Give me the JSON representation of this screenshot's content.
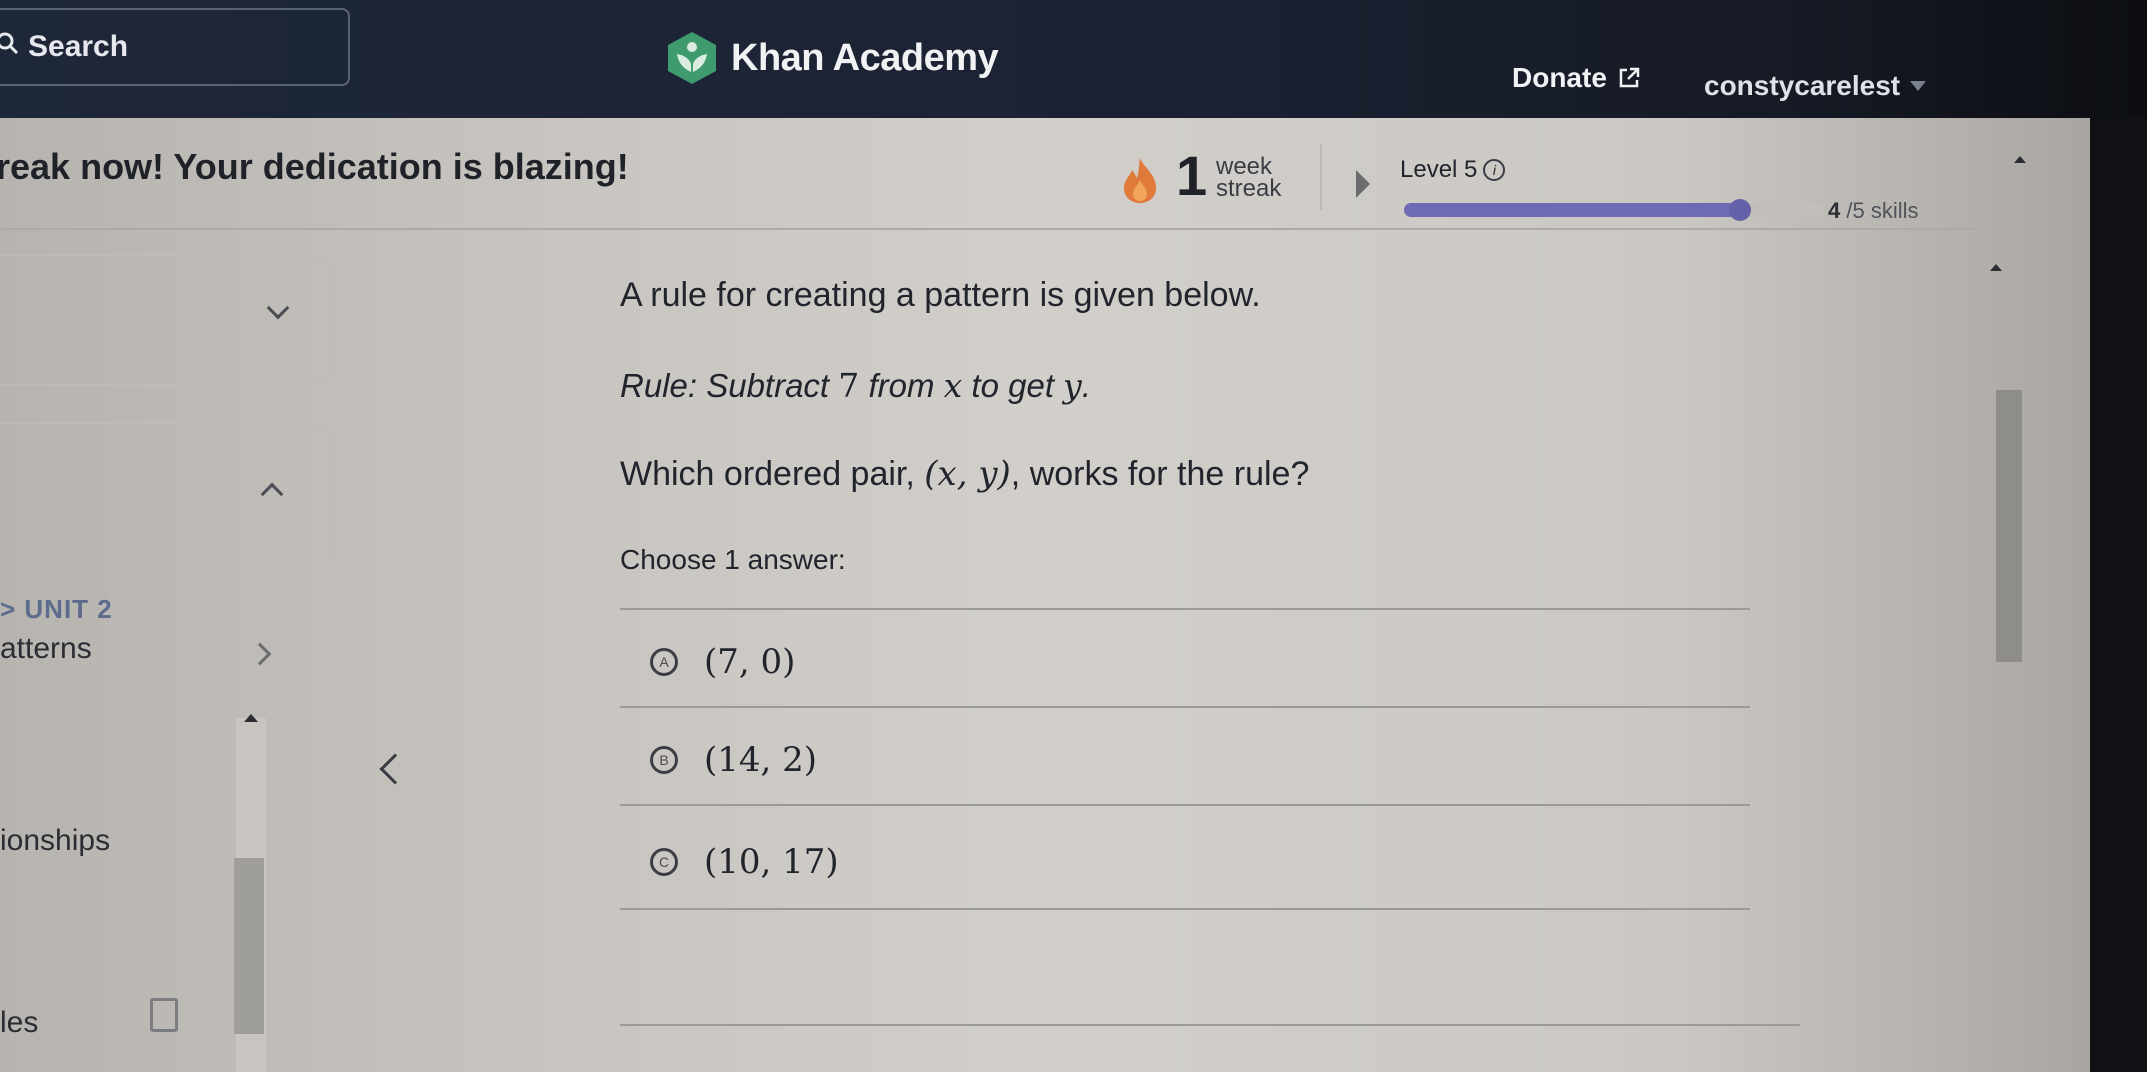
{
  "nav": {
    "search_label": "Search",
    "brand": "Khan Academy",
    "donate_label": "Donate",
    "username": "constycarelest"
  },
  "streak": {
    "message": "reak now! Your dedication is blazing!",
    "count": "1",
    "unit_line1": "week",
    "unit_line2": "streak"
  },
  "level": {
    "label": "Level 5",
    "skills_done": "4",
    "skills_total_label": "/5 skills",
    "progress_fraction": 0.8
  },
  "sidebar": {
    "unit_label": "> UNIT 2",
    "items": [
      {
        "label": "atterns"
      },
      {
        "label": "ionships"
      },
      {
        "label": "les"
      }
    ]
  },
  "question": {
    "intro": "A rule for creating a pattern is given below.",
    "rule_prefix": "Rule: Subtract ",
    "rule_number": "7",
    "rule_mid": " from ",
    "rule_var_x": "x",
    "rule_to": " to get ",
    "rule_var_y": "y",
    "rule_end": ".",
    "ask_prefix": "Which ordered pair, ",
    "ask_math": "(x, y)",
    "ask_suffix": ", works for the rule?",
    "choose_label": "Choose 1 answer:"
  },
  "choices": [
    {
      "letter": "A",
      "text": "(7, 0)"
    },
    {
      "letter": "B",
      "text": "(14, 2)"
    },
    {
      "letter": "C",
      "text": "(10, 17)"
    }
  ],
  "colors": {
    "nav_bg": "#1e2738",
    "logo_green": "#3f9a6e",
    "progress": "#6e6ab4",
    "flame": "#e07a3a"
  }
}
